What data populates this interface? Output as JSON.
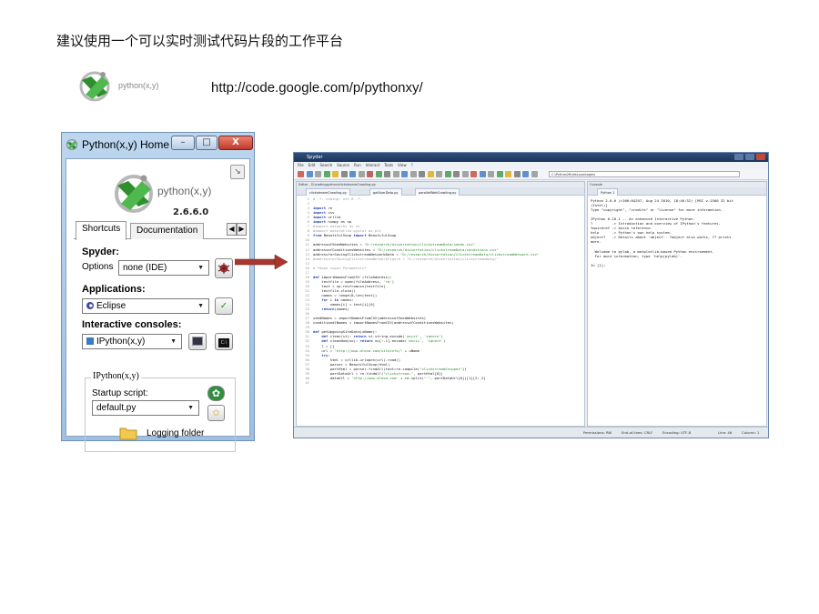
{
  "heading": "建议使用一个可以实时测试代码片段的工作平台",
  "logo_text": "python(x,y)",
  "url": "http://code.google.com/p/pythonxy/",
  "pxy_window": {
    "title": "Python(x,y) Home",
    "logo_text": "python(x,y)",
    "version": "2.6.6.0",
    "tabs": [
      "Shortcuts",
      "Documentation"
    ],
    "spyder_label": "Spyder:",
    "options_label": "Options",
    "options_value": "none (IDE)",
    "applications_label": "Applications:",
    "applications_value": "Eclipse",
    "consoles_label": "Interactive consoles:",
    "consoles_value": "IPython(x,y)",
    "ipython_group": "IPython(x,y)",
    "startup_label": "Startup script:",
    "startup_value": "default.py",
    "logging_label": "Logging folder"
  },
  "spyder": {
    "title": "Spyder",
    "menu": [
      "File",
      "Edit",
      "Search",
      "Source",
      "Run",
      "Interact",
      "Tools",
      "View",
      "?"
    ],
    "path": "C:\\Python26\\dist-packages\\",
    "editor_label": "Editor - D:\\codingpython\\clickstreamCrawling.py",
    "editor_tabs": [
      "clickstreamCrawling.py",
      "getUserData.py",
      "parallelWebCrawling.py"
    ],
    "console_label": "Console",
    "console_tab": "Python 1",
    "code_lines": [
      "# -*- coding: utf-8 -*-",
      "",
      "import re",
      "import csv",
      "import urllib",
      "import numpy as np",
      "#import networkx as nx",
      "#import matplotlib.pyplot as plt",
      "from BeautifulSoup import BeautifulSoup",
      "",
      "addressofSeedWebsites = \"D:/research/dissertation/clickstreamData/seeds.csv\"",
      "addressofConditionsWebsites = \"D:/research/dissertation/clickstreamData/conditions.csv\"",
      "addressforSavingClickstreamNetworkData = \"D:/research/dissertation/clickstreamData/clickstreamNetwork.csv\"",
      "#addressforSavingClickstreamNetworkFigure = \"D:/research/dissertation/clickstreamData/\"",
      "",
      "# *Open input Parameters*",
      "",
      "def importNamesFromCSV (fileAddress):",
      "    testfile = open(fileAddress, 'rb')",
      "    text = np.recfromcsv(testfile)",
      "    testfile.close()",
      "    names = range(0,len(text))",
      "    for i in names:",
      "        names[i] = text[i][0]",
      "    return(names)",
      "",
      "seedNames = importNamesFromCSV(addressofSeedWebsites)",
      "conditionalNames = importNamesFromCSV(addressofConditionsWebsites)",
      "",
      "def getUpgoingSiteData(uName):",
      "    def clean(st): return st.string.encode('ascii', 'ignore')",
      "    def cleanNum(nu): return nu[:-1].encode('ascii', 'ignore')",
      "    l = []",
      "    url = \"http://www.alexa.com/siteinfo/\" + uName",
      "    try:",
      "        html = urllib.urlopen(url).read()",
      "        parser = BeautifulSoup(html)",
      "        partHtml = parser.findAll(text=re.compile(\"clickstreamSnippet\"))",
      "        partDataUrl = re.findall(\"clickstream-\", partHtml[0])",
      "        dataUrl = 'http://www.alexa.com' + re.split(\"'\", partDataUrl[0])[1][2:-2]",
      ""
    ],
    "console_lines": [
      "Python 2.6.6 (r266:84297, Aug 24 2010, 18:46:32) [MSC v.1500 32 bit",
      "(Intel)]",
      "Type \"copyright\", \"credits\" or \"license\" for more information.",
      "",
      "IPython 0.10.1 -- An enhanced Interactive Python.",
      "?         -> Introduction and overview of IPython's features.",
      "%quickref -> Quick reference.",
      "help      -> Python's own help system.",
      "object?   -> Details about 'object'. ?object also works, ?? prints",
      "more.",
      "",
      "  Welcome to pylab, a matplotlib-based Python environment.",
      "  For more information, type 'help(pylab)'.",
      "",
      "In [1]:"
    ],
    "status": {
      "permissions": "Permissions: RW",
      "eol": "End-of-lines: CRLF",
      "encoding": "Encoding: UTF-8",
      "line": "Line: 46",
      "column": "Column: 1"
    }
  }
}
